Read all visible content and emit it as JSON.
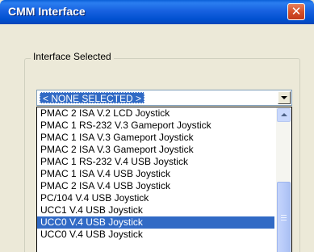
{
  "window": {
    "title": "CMM Interface",
    "close_symbol": "✕"
  },
  "group": {
    "label": "Interface Selected"
  },
  "combo": {
    "value": "< NONE SELECTED >"
  },
  "dropdown": {
    "items": [
      "PMAC 2 ISA V.2 LCD Joystick",
      "PMAC 1 RS-232 V.3 Gameport Joystick",
      "PMAC 1 ISA V.3 Gameport Joystick",
      "PMAC 2 ISA V.3 Gameport Joystick",
      "PMAC 1 RS-232 V.4 USB Joystick",
      "PMAC 1 ISA V.4 USB Joystick",
      "PMAC 2 ISA V.4 USB Joystick",
      "PC/104 V.4 USB Joystick",
      "UCC1 V.4 USB Joystick",
      "UCC0 V.4 USB Joystick",
      "UCC0 V.4 USB Joystick"
    ],
    "selected_index": 9
  },
  "colors": {
    "titlebar": "#0050d0",
    "selection": "#316ac5",
    "window_bg": "#ece9d8"
  }
}
